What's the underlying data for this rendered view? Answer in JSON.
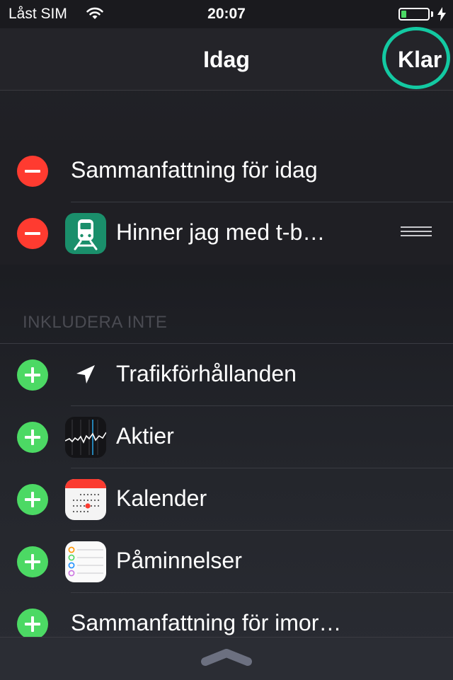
{
  "status_bar": {
    "carrier": "Låst SIM",
    "time": "20:07",
    "battery_level": 0.2
  },
  "nav": {
    "title": "Idag",
    "done_label": "Klar"
  },
  "included": [
    {
      "label": "Sammanfattning för idag",
      "action": "remove"
    },
    {
      "label": "Hinner jag med t-b…",
      "action": "remove",
      "icon": "train-app-icon"
    }
  ],
  "excluded_header": "INKLUDERA INTE",
  "excluded": [
    {
      "label": "Trafikförhållanden",
      "action": "add",
      "icon": "location-arrow-icon"
    },
    {
      "label": "Aktier",
      "action": "add",
      "icon": "stocks-app-icon"
    },
    {
      "label": "Kalender",
      "action": "add",
      "icon": "calendar-app-icon"
    },
    {
      "label": "Påminnelser",
      "action": "add",
      "icon": "reminders-app-icon"
    },
    {
      "label": "Sammanfattning för imor…",
      "action": "add"
    }
  ],
  "colors": {
    "remove": "#ff3b30",
    "add": "#4cd964",
    "highlight": "#13c9a2",
    "train_icon": "#1a8f6b"
  }
}
